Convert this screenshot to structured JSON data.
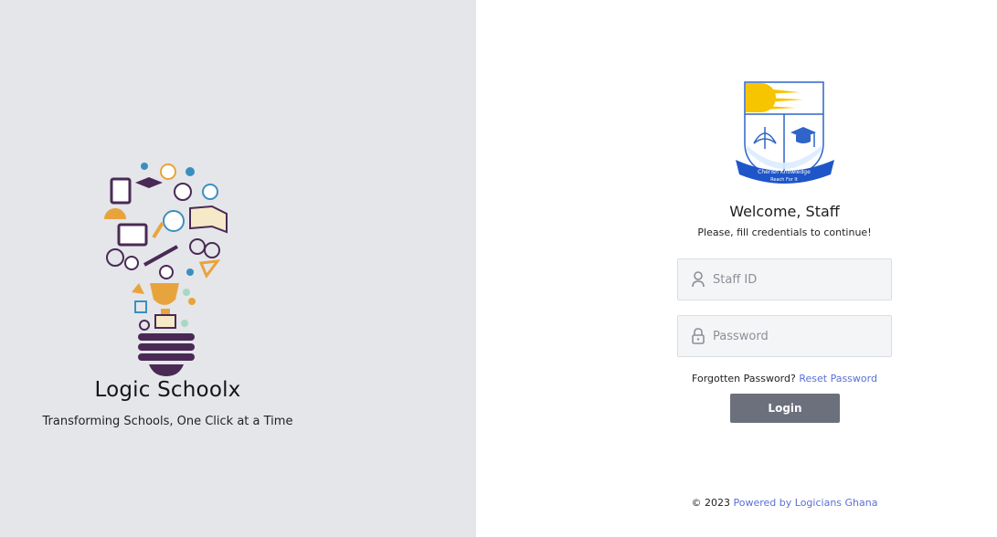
{
  "brand": {
    "name": "Logic Schoolx",
    "tagline": "Transforming Schools, One Click at a Time"
  },
  "crest": {
    "motto_line1": "Cherish Knowledge",
    "motto_line2": "Reach For It"
  },
  "login": {
    "welcome": "Welcome, Staff",
    "subtitle": "Please, fill credentials to continue!",
    "staff_id_placeholder": "Staff ID",
    "password_placeholder": "Password",
    "forgot_text": "Forgotten Password?",
    "reset_link": "Reset Password",
    "login_button": "Login"
  },
  "footer": {
    "copyright": "© 2023",
    "powered_link": "Powered by Logicians Ghana"
  },
  "colors": {
    "left_bg": "#e5e6ea",
    "accent_link": "#5b6fd6",
    "button_bg": "#6c707c",
    "bulb_base": "#4a2a55"
  },
  "icons": {
    "staff_field": "user-icon",
    "password_field": "lock-icon"
  }
}
